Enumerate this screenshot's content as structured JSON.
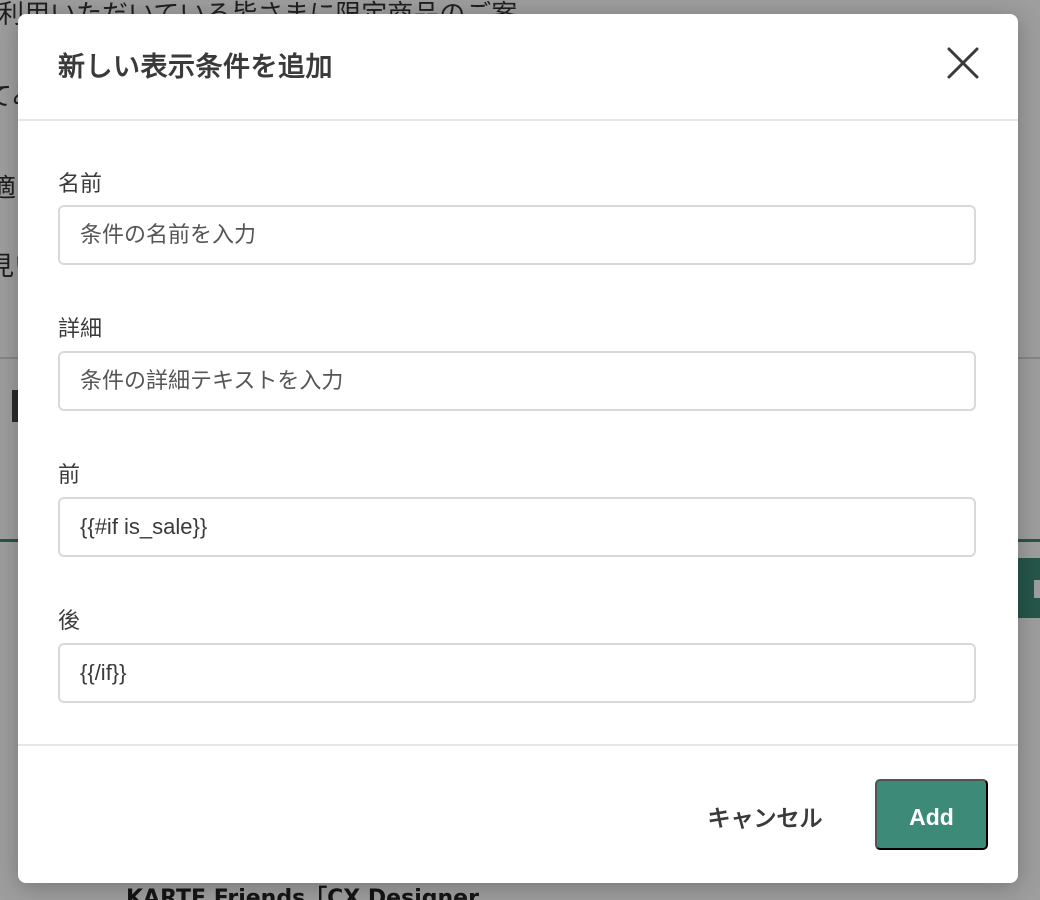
{
  "background": {
    "line1": "利用いただいている皆さまに限定商品のご案",
    "line2": "てみ",
    "line3": "適",
    "line4": "見い",
    "bottom_text": "KARTE Friends「CX Designer"
  },
  "dialog": {
    "title": "新しい表示条件を追加",
    "close_icon": "close-icon",
    "fields": {
      "name": {
        "label": "名前",
        "placeholder": "条件の名前を入力",
        "value": ""
      },
      "detail": {
        "label": "詳細",
        "placeholder": "条件の詳細テキストを入力",
        "value": ""
      },
      "before": {
        "label": "前",
        "placeholder": "",
        "value": "{{#if is_sale}}"
      },
      "after": {
        "label": "後",
        "placeholder": "",
        "value": "{{/if}}"
      }
    },
    "footer": {
      "cancel_label": "キャンセル",
      "add_label": "Add"
    }
  },
  "colors": {
    "accent": "#3e8a78",
    "text": "#3a3a3a",
    "border": "#d9d9d9"
  }
}
